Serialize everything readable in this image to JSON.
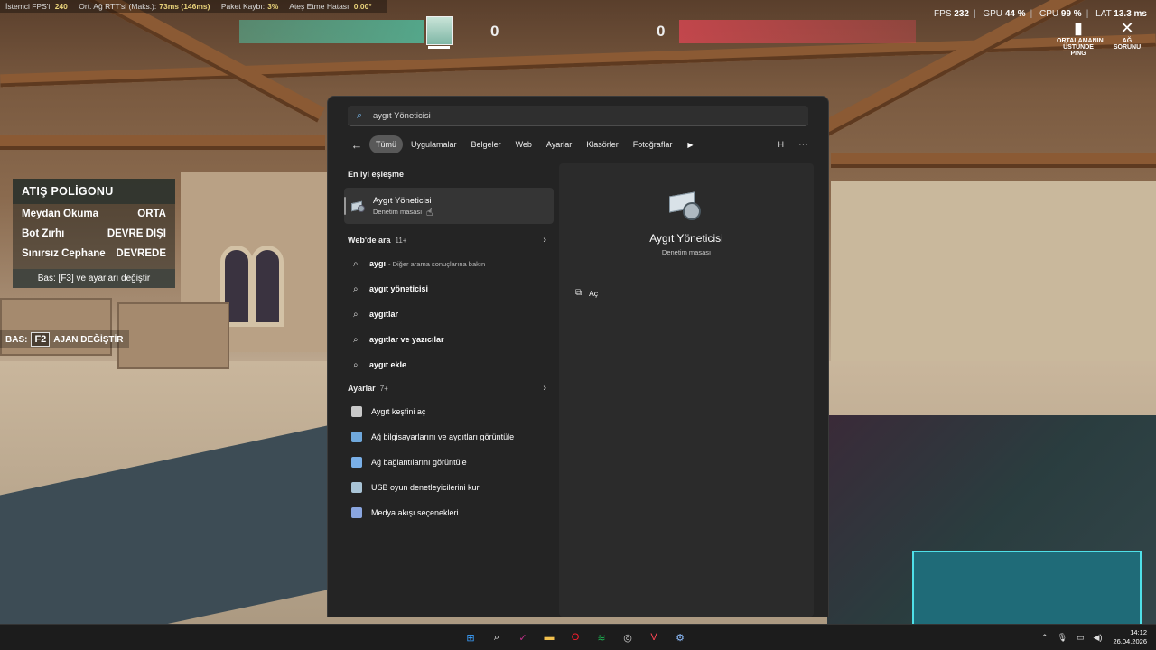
{
  "hud": {
    "net_stats": [
      {
        "label": "İstemci FPS'i:",
        "value": "240"
      },
      {
        "label": "Ort. Ağ RTT'si (Maks.):",
        "value": "73ms (146ms)"
      },
      {
        "label": "Paket Kaybı:",
        "value": "3%"
      },
      {
        "label": "Ateş Etme Hatası:",
        "value": "0.00°"
      }
    ],
    "perf": {
      "fps_label": "FPS",
      "fps_value": "232",
      "gpu_label": "GPU",
      "gpu_value": "44 %",
      "cpu_label": "CPU",
      "cpu_value": "99 %",
      "lat_label": "LAT",
      "lat_value": "13.3 ms"
    },
    "score_left": "0",
    "score_right": "0",
    "net_warnings": [
      {
        "icon": "signal-bars-icon",
        "text": "ORTALAMANIN ÜSTÜNDE PING"
      },
      {
        "icon": "network-problem-icon",
        "text": "AĞ SORUNU"
      }
    ],
    "range_panel": {
      "title": "ATIŞ POLİGONU",
      "rows": [
        {
          "label": "Meydan Okuma",
          "value": "ORTA"
        },
        {
          "label": "Bot Zırhı",
          "value": "DEVRE DIŞI"
        },
        {
          "label": "Sınırsız Cephane",
          "value": "DEVREDE"
        }
      ],
      "hint": "Bas: [F3] ve ayarları değiştir"
    },
    "agent_switch": {
      "prefix": "BAS:",
      "key": "F2",
      "label": "AJAN DEĞİŞTİR"
    }
  },
  "search": {
    "query": "aygıt Yöneticisi",
    "filters": [
      "Tümü",
      "Uygulamalar",
      "Belgeler",
      "Web",
      "Ayarlar",
      "Klasörler",
      "Fotoğraflar"
    ],
    "active_filter": "Tümü",
    "avatar_letter": "H",
    "best_match_header": "En iyi eşleşme",
    "best_match": {
      "title": "Aygıt Yöneticisi",
      "subtitle": "Denetim masası"
    },
    "web_header": "Web'de ara",
    "web_count": "11+",
    "web_items": [
      {
        "bold": "aygı",
        "hint": "- Diğer arama sonuçlarına bakın"
      },
      {
        "bold": "aygıt yöneticisi",
        "hint": ""
      },
      {
        "bold": "aygıtlar",
        "hint": ""
      },
      {
        "bold": "aygıtlar ve yazıcılar",
        "hint": ""
      },
      {
        "bold": "aygıt ekle",
        "hint": ""
      }
    ],
    "settings_header": "Ayarlar",
    "settings_count": "7+",
    "settings_items": [
      {
        "label": "Aygıt keşfini aç",
        "color": "#c9c9c9"
      },
      {
        "label": "Ağ bilgisayarlarını ve aygıtları görüntüle",
        "color": "#6fa8dc"
      },
      {
        "label": "Ağ bağlantılarını görüntüle",
        "color": "#7ab0e8"
      },
      {
        "label": "USB oyun denetleyicilerini kur",
        "color": "#a9c4d6"
      },
      {
        "label": "Medya akışı seçenekleri",
        "color": "#8aa6e0"
      }
    ],
    "detail": {
      "title": "Aygıt Yöneticisi",
      "subtitle": "Denetim masası",
      "open_label": "Aç"
    }
  },
  "taskbar": {
    "icons": [
      {
        "name": "start-icon",
        "glyph": "⊞",
        "color": "#3aa0ff"
      },
      {
        "name": "search-icon",
        "glyph": "⌕",
        "color": "#ffffff"
      },
      {
        "name": "app-icon",
        "glyph": "✓",
        "color": "#c0308a"
      },
      {
        "name": "folder-icon",
        "glyph": "▬",
        "color": "#f2c14e"
      },
      {
        "name": "opera-icon",
        "glyph": "O",
        "color": "#ff1b2d"
      },
      {
        "name": "spotify-icon",
        "glyph": "≋",
        "color": "#1db954"
      },
      {
        "name": "steam-icon",
        "glyph": "◎",
        "color": "#cfcfcf"
      },
      {
        "name": "valorant-icon",
        "glyph": "V",
        "color": "#ff4655"
      },
      {
        "name": "settings-icon",
        "glyph": "⚙",
        "color": "#8fbfff"
      }
    ],
    "time": "14:12",
    "date": "26.04.2026"
  }
}
